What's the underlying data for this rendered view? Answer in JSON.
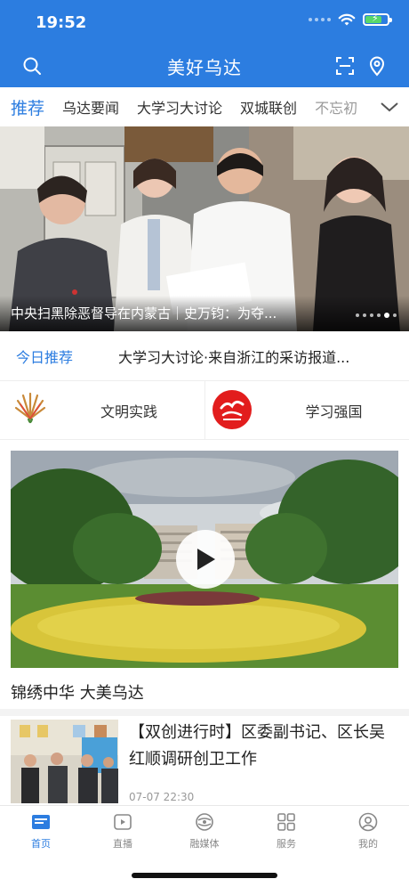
{
  "status_bar": {
    "time": "19:52"
  },
  "header": {
    "title": "美好乌达"
  },
  "tabs": [
    {
      "label": "推荐"
    },
    {
      "label": "乌达要闻"
    },
    {
      "label": "大学习大讨论"
    },
    {
      "label": "双城联创"
    },
    {
      "label": "不忘初"
    }
  ],
  "hero": {
    "caption": "中央扫黑除恶督导在内蒙古｜史万钧：为夺...",
    "slide_count": 6,
    "active_slide": 5
  },
  "today": {
    "label": "今日推荐",
    "text": "大学习大讨论·来自浙江的采访报道..."
  },
  "shortcuts": [
    {
      "label": "文明实践",
      "icon": "civilization-practice-icon"
    },
    {
      "label": "学习强国",
      "icon": "xuexi-qiangguo-icon"
    }
  ],
  "video": {
    "title": "锦绣中华 大美乌达"
  },
  "news": [
    {
      "title": "【双创进行时】区委副书记、区长吴红顺调研创卫工作",
      "time": "07-07 22:30"
    }
  ],
  "bottom_nav": [
    {
      "label": "首页",
      "icon": "home-icon"
    },
    {
      "label": "直播",
      "icon": "live-icon"
    },
    {
      "label": "融媒体",
      "icon": "media-icon"
    },
    {
      "label": "服务",
      "icon": "services-icon"
    },
    {
      "label": "我的",
      "icon": "profile-icon"
    }
  ],
  "colors": {
    "primary": "#2c7de0",
    "battery": "#58d86a"
  }
}
